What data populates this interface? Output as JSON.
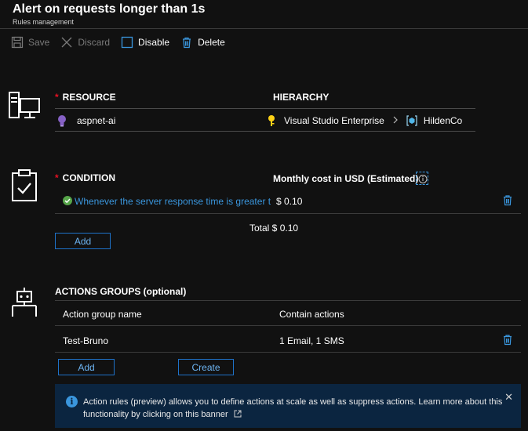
{
  "header": {
    "title": "Alert on requests longer than 1s",
    "subtitle": "Rules management"
  },
  "toolbar": {
    "save": "Save",
    "discard": "Discard",
    "disable": "Disable",
    "delete": "Delete"
  },
  "resource": {
    "label": "RESOURCE",
    "hierarchy_label": "HIERARCHY",
    "name": "aspnet-ai",
    "subscription": "Visual Studio Enterprise",
    "resource_group": "HildenCo"
  },
  "condition": {
    "label": "CONDITION",
    "cost_label": "Monthly cost in USD (Estimated)",
    "item_text": "Whenever the server response time is greater t...",
    "item_cost": "$ 0.10",
    "total": "Total $ 0.10",
    "add_label": "Add"
  },
  "actions": {
    "label": "ACTIONS GROUPS (optional)",
    "col_name": "Action group name",
    "col_actions": "Contain actions",
    "rows": [
      {
        "name": "Test-Bruno",
        "actions": "1 Email, 1 SMS"
      }
    ],
    "add_label": "Add",
    "create_label": "Create"
  },
  "banner": {
    "text": "Action rules (preview) allows you to define actions at scale as well as suppress actions. Learn more about this functionality by clicking on this banner"
  },
  "colors": {
    "accent": "#3a96dd",
    "required": "#e81123",
    "success": "#57a64a",
    "background": "#111111"
  }
}
